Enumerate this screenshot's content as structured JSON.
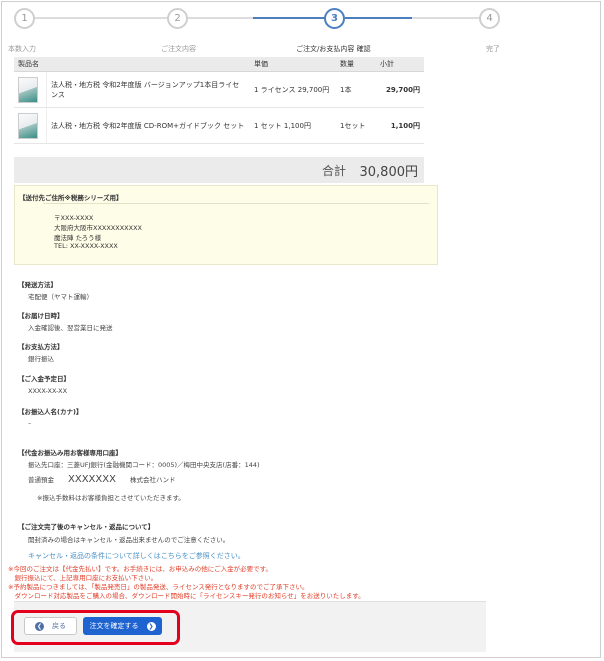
{
  "stepper": {
    "steps": [
      {
        "num": "1",
        "label": "本数入力"
      },
      {
        "num": "2",
        "label": "ご注文内容"
      },
      {
        "num": "3",
        "label": "ご注文/お支払内容 確認"
      },
      {
        "num": "4",
        "label": "完了"
      }
    ],
    "current": 3
  },
  "table": {
    "headers": {
      "name": "製品名",
      "price": "単価",
      "qty": "数量",
      "subtotal": "小計"
    },
    "rows": [
      {
        "name": "法人税・地方税 令和2年度版 バージョンアップ1本目ライセンス",
        "price": "1 ライセンス 29,700円",
        "qty": "1本",
        "subtotal": "29,700円"
      },
      {
        "name": "法人税・地方税 令和2年度版 CD-ROM+ガイドブック セット",
        "price": "1 セット 1,100円",
        "qty": "1セット",
        "subtotal": "1,100円"
      }
    ],
    "total_label": "合計",
    "total_value": "30,800円"
  },
  "shipping": {
    "heading": "【送付先ご住所※税務シリーズ用】",
    "postal": "〒XXX-XXXX",
    "address": "大阪府大阪市XXXXXXXXXXX",
    "name": "魔法陣 たろう様",
    "tel": "TEL: XX-XXXX-XXXX"
  },
  "sections": {
    "method_h": "【発送方法】",
    "method_v": "宅配便（ヤマト運輸）",
    "delivery_h": "【お届け日時】",
    "delivery_v": "入金確認後、翌営業日に発送",
    "payment_h": "【お支払方法】",
    "payment_v": "銀行振込",
    "date_h": "【ご入金予定日】",
    "date_v": "XXXX-XX-XX",
    "kana_h": "【お振込人名(カナ)】",
    "kana_v": "–",
    "bank_h": "【代金お振込み用お客様専用口座】",
    "bank_line1": "振込先口座：三菱UFJ銀行(金融機関コード：0005)／梅田中央支店(店番：144)",
    "bank_type": "普通預金",
    "bank_acct": "XXXXXXX",
    "bank_holder": "株式会社ハンド",
    "bank_fee": "※振込手数料はお客様負担とさせていただきます。",
    "cancel_h": "【ご注文完了後のキャンセル・返品について】",
    "cancel_v": "開封済みの場合はキャンセル・返品出来ませんのでご注意ください。",
    "cancel_link": "キャンセル・返品の条件について詳しくはこちらをご参照ください。"
  },
  "notes": [
    "※今回のご注文は【代金先払い】です。お手続きには、お申込みの他にご入金が必要です。",
    "　銀行振込にて、上記専用口座にお支払い下さい。",
    "※予約製品につきましては、「製品発売日」の製品発送、ライセンス発行となりますのでご了承下さい。",
    "　ダウンロード対応製品をご購入の場合、ダウンロード開始時に「ライセンスキー発行のお知らせ」をお送りいたします。"
  ],
  "buttons": {
    "back": "戻る",
    "confirm": "注文を確定する"
  },
  "colors": {
    "accent": "#1e63d0",
    "highlight": "#e4001c",
    "note_red": "#e2402b"
  }
}
